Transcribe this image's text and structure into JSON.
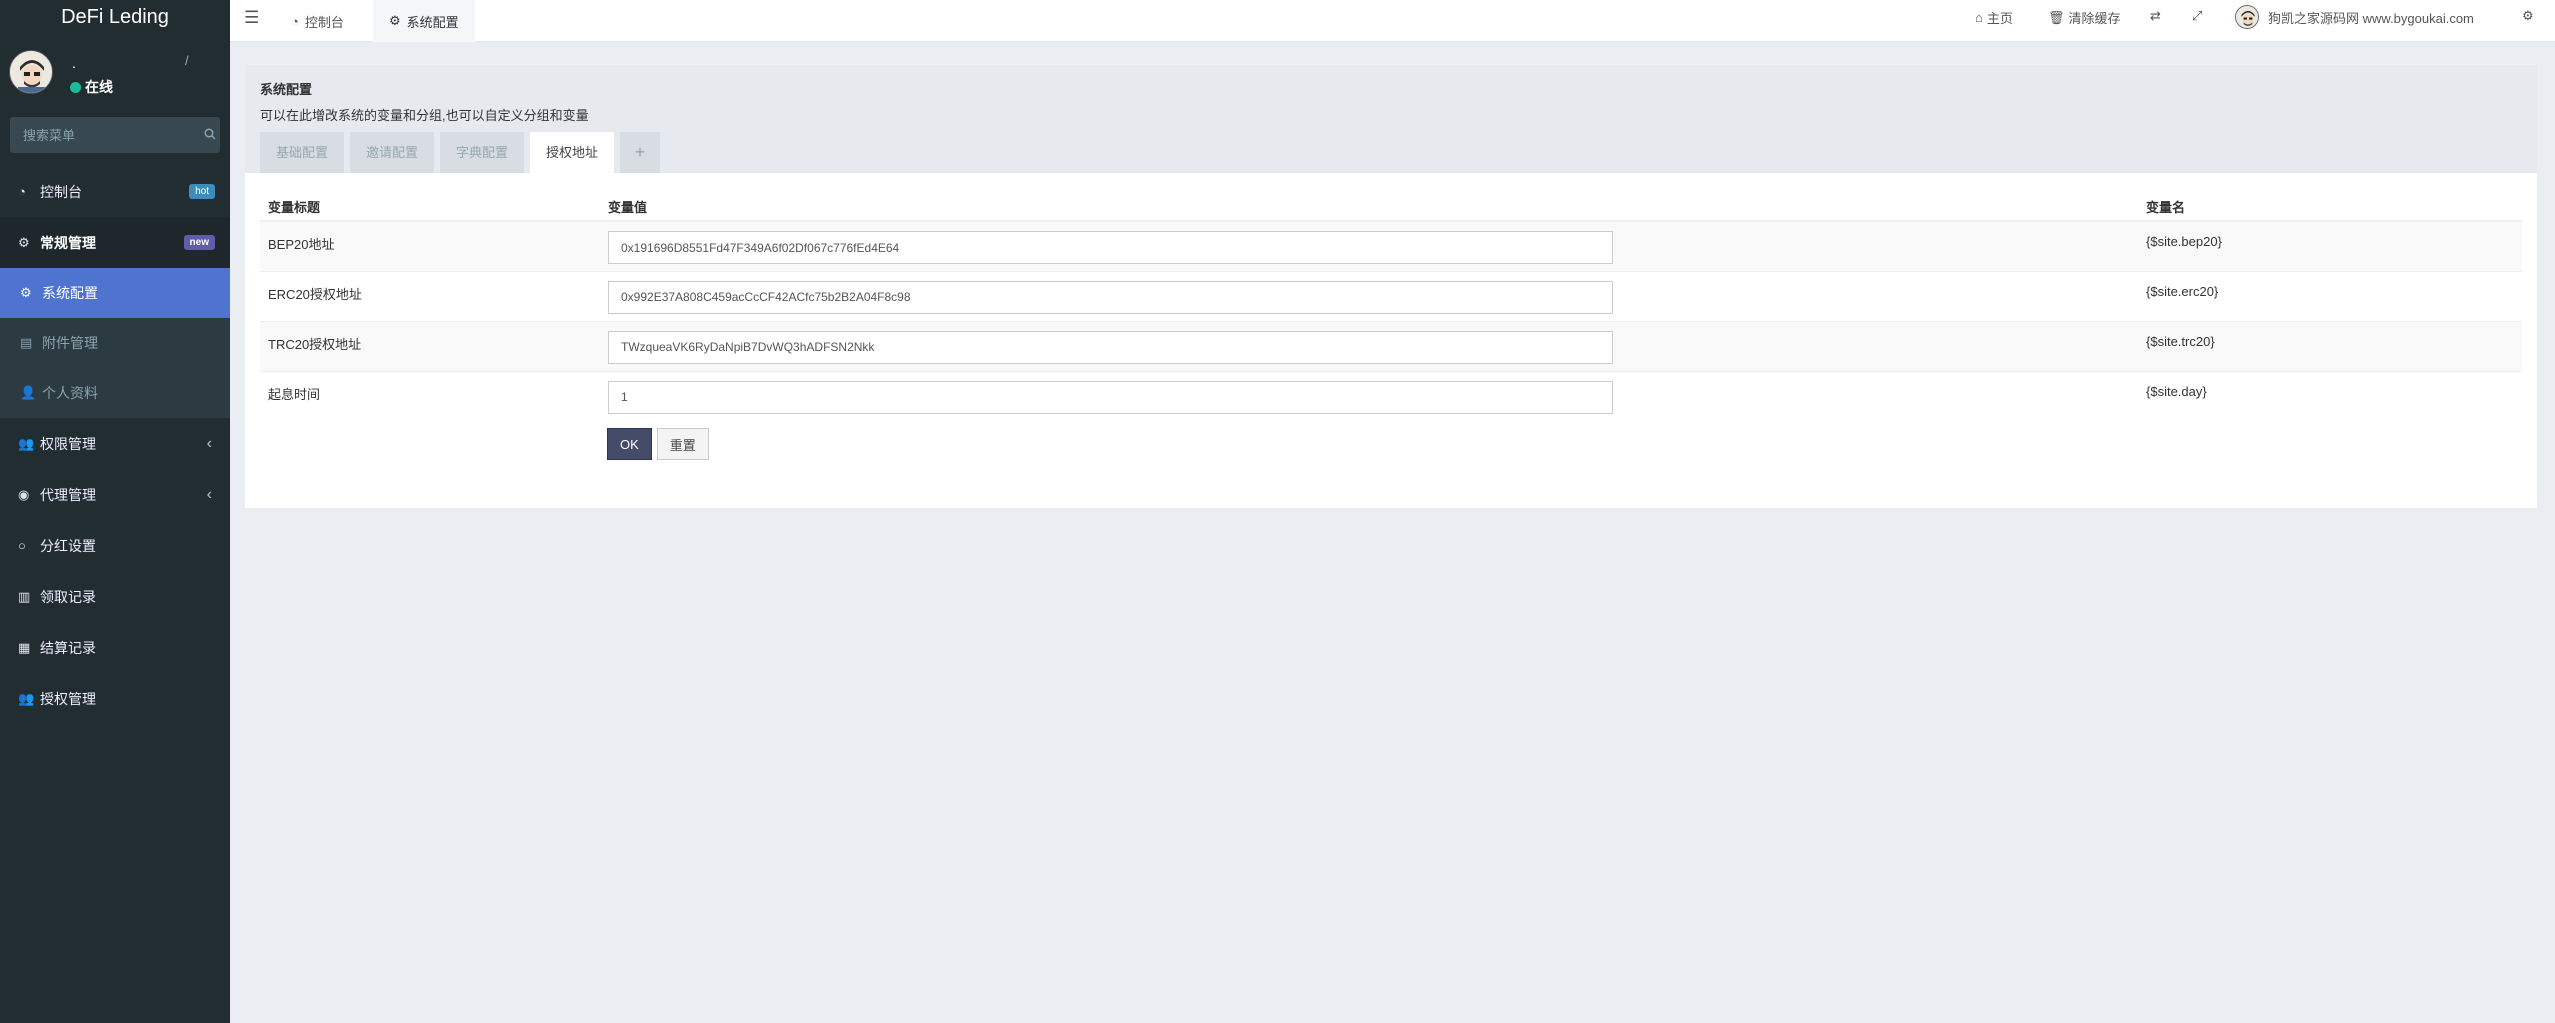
{
  "brand": "DeFi Leding",
  "user": {
    "name": ".",
    "slash": "/",
    "status": "在线"
  },
  "sidebar_search_placeholder": "搜索菜单",
  "menu": {
    "dashboard": {
      "label": "控制台",
      "badge": "hot"
    },
    "general": {
      "label": "常规管理",
      "badge": "new"
    },
    "system_config": "系统配置",
    "attachments": "附件管理",
    "profile": "个人资料",
    "permissions": "权限管理",
    "agents": "代理管理",
    "dividend": "分红设置",
    "claims": "领取记录",
    "settlements": "结算记录",
    "authorization": "授权管理"
  },
  "topbar": {
    "tabs": [
      "控制台",
      "系统配置"
    ],
    "home": "主页",
    "clear_cache": "清除缓存",
    "username": "狗凯之家源码网 www.bygoukai.com"
  },
  "panel": {
    "title": "系统配置",
    "description": "可以在此增改系统的变量和分组,也可以自定义分组和变量",
    "tabs": [
      "基础配置",
      "邀请配置",
      "字典配置",
      "授权地址"
    ],
    "add_tab": "+"
  },
  "table": {
    "headers": [
      "变量标题",
      "变量值",
      "变量名"
    ],
    "rows": [
      {
        "title": "BEP20地址",
        "value": "0x191696D8551Fd47F349A6f02Df067c776fEd4E64",
        "name": "{$site.bep20}"
      },
      {
        "title": "ERC20授权地址",
        "value": "0x992E37A808C459acCcCF42ACfc75b2B2A04F8c98",
        "name": "{$site.erc20}"
      },
      {
        "title": "TRC20授权地址",
        "value": "TWzqueaVK6RyDaNpiB7DvWQ3hADFSN2Nkk",
        "name": "{$site.trc20}"
      },
      {
        "title": "起息时间",
        "value": "1",
        "name": "{$site.day}"
      }
    ]
  },
  "buttons": {
    "ok": "OK",
    "reset": "重置"
  },
  "colors": {
    "sidebar": "#222d32",
    "active_menu": "#4e74cf",
    "ok_button": "#444c69",
    "status_dot": "#18bc9c"
  }
}
